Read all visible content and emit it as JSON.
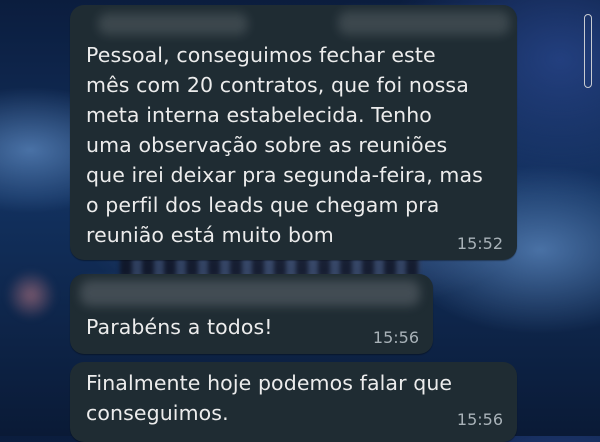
{
  "messages": [
    {
      "text": "Pessoal, conseguimos fechar este\nmês com 20 contratos, que foi nossa\nmeta interna estabelecida. Tenho\numa observação sobre as reuniões\nque irei deixar pra segunda-feira, mas\no perfil dos leads que chegam pra\nreunião está muito bom",
      "time": "15:52"
    },
    {
      "text": "Parabéns a todos!",
      "time": "15:56"
    },
    {
      "text": "Finalmente hoje podemos falar que\nconseguimos.",
      "time": "15:56"
    }
  ],
  "colors": {
    "bubble": "#1f2c33",
    "text": "#ececec",
    "timestamp": "#a8b2b8",
    "background": "#12315f"
  }
}
